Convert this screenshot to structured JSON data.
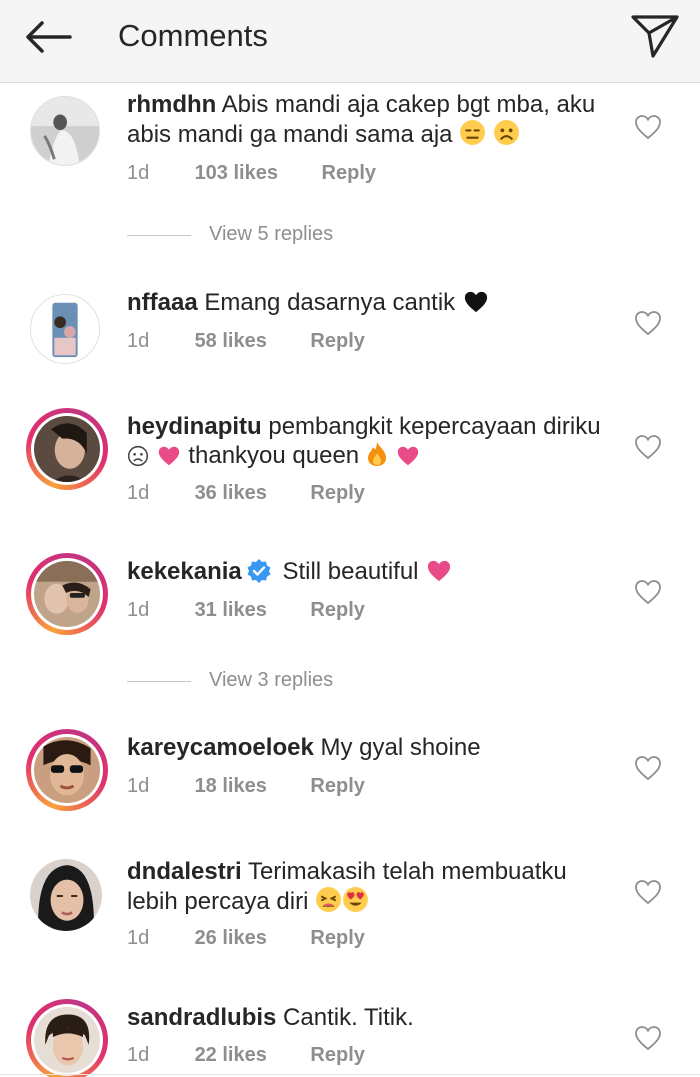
{
  "header": {
    "title": "Comments",
    "back_icon": "back-arrow-icon",
    "send_icon": "paper-plane-icon"
  },
  "comments": [
    {
      "username": "rhmdhn",
      "text": "Abis mandi aja cakep bgt mba, aku abis mandi ga mandi sama aja",
      "emoji": "😑☹️",
      "time": "1d",
      "likes": "103 likes",
      "reply": "Reply"
    },
    {
      "username": "nffaaa",
      "text": "Emang dasarnya cantik",
      "emoji": "🖤",
      "time": "1d",
      "likes": "58 likes",
      "reply": "Reply"
    },
    {
      "username": "heydinapitu",
      "text": "pembangkit kepercayaan diriku",
      "text2": "thankyou queen",
      "time": "1d",
      "likes": "36 likes",
      "reply": "Reply"
    },
    {
      "username": "kekekania",
      "text": "Still beautiful",
      "time": "1d",
      "likes": "31 likes",
      "reply": "Reply"
    },
    {
      "username": "kareycamoeloek",
      "text": "My gyal shoine",
      "time": "1d",
      "likes": "18 likes",
      "reply": "Reply"
    },
    {
      "username": "dndalestri",
      "text": "Terimakasih telah membuatku lebih percaya diri",
      "emoji": "😫😍",
      "time": "1d",
      "likes": "26 likes",
      "reply": "Reply"
    },
    {
      "username": "sandradlubis",
      "text": "Cantik. Titik.",
      "time": "1d",
      "likes": "22 likes",
      "reply": "Reply"
    }
  ],
  "view_replies": [
    {
      "label": "View 5 replies"
    },
    {
      "label": "View 3 replies"
    }
  ],
  "colors": {
    "text": "#262626",
    "muted": "#8e8e8e",
    "verified": "#3897f0",
    "heart_pink": "#e84b87"
  }
}
